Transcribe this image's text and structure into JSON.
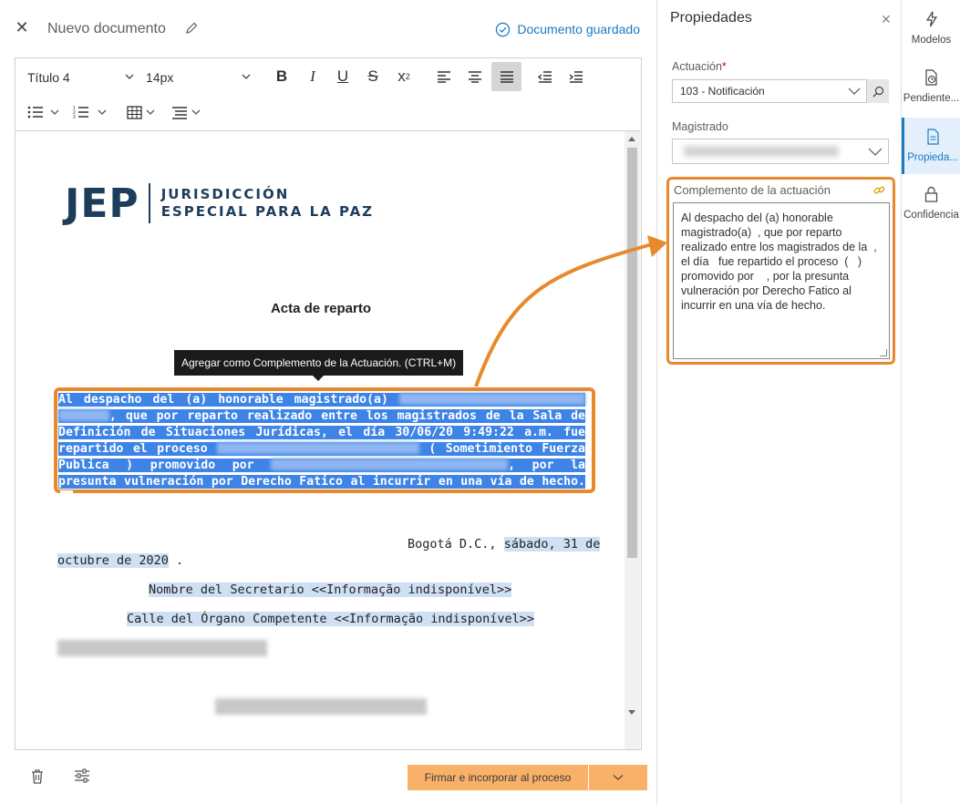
{
  "header": {
    "title": "Nuevo documento",
    "saved_status": "Documento guardado"
  },
  "toolbar": {
    "heading_select": "Título 4",
    "size_select": "14px"
  },
  "document": {
    "org_short": "JEP",
    "org_line1": "JURISDICCIÓN",
    "org_line2": "ESPECIAL PARA LA PAZ",
    "title": "Acta de reparto",
    "tooltip": "Agregar como Complemento de la Actuación. (CTRL+M)",
    "sel_1a": "Al despacho del (a) honorable magistrado(a)",
    "sel_2": ", que por reparto realizado entre los magistrados de la Sala de Definición de Situaciones Jurídicas, el día 30/06/20 9:49:22 a.m. fue repartido el proceso",
    "sel_3": "( Sometimiento Fuerza Publica ) promovido por",
    "sel_4": ", por la presunta vulneración por Derecho Fatico al incurrir en una vía de hecho.",
    "city": "Bogotá D.C.,",
    "date_a": "sábado, 31 de",
    "date_b": "octubre de 2020",
    "date_end": " .",
    "secretary": "Nombre del Secretario <<Informação indisponível>>",
    "address": "Calle del Órgano Competente <<Informação indisponível>>"
  },
  "footer": {
    "sign_button": "Firmar e incorporar al proceso"
  },
  "properties": {
    "title": "Propiedades",
    "actuacion_label": "Actuación",
    "actuacion_required": "*",
    "actuacion_value": "103 - Notificación",
    "magistrado_label": "Magistrado",
    "complemento_label": "Complemento de la actuación",
    "complemento_value": "Al despacho del (a) honorable magistrado(a)  , que por reparto realizado entre los magistrados de la  , el día   fue repartido el proceso  (   ) promovido por    , por la presunta vulneración por Derecho Fatico al incurrir en una vía de hecho."
  },
  "nav": {
    "items": [
      {
        "label": "Modelos",
        "icon": "lightning-icon",
        "active": false
      },
      {
        "label": "Pendiente...",
        "icon": "clock-document-icon",
        "active": false
      },
      {
        "label": "Propieda...",
        "icon": "document-icon",
        "active": true
      },
      {
        "label": "Confidencia",
        "icon": "lock-icon",
        "active": false
      }
    ]
  },
  "colors": {
    "accent": "#1a7ac4",
    "highlight_orange": "#e8892c",
    "selection_blue": "#3d84e6",
    "sign_button": "#f9b16a"
  }
}
